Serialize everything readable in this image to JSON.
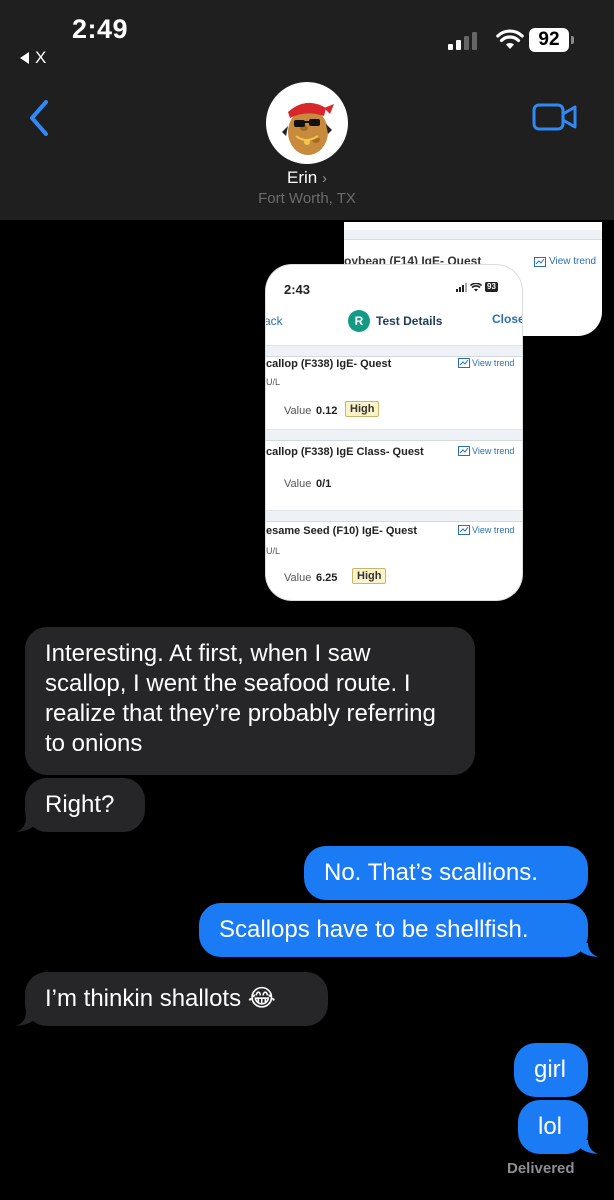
{
  "status_bar": {
    "time": "2:49",
    "back_app": "X",
    "battery": "92"
  },
  "header": {
    "contact_name": "Erin",
    "contact_location": "Fort Worth, TX"
  },
  "attachment": {
    "back_card": {
      "row_title": "oybean (F14) IgE- Quest",
      "trend_label": "View trend"
    },
    "front_card": {
      "time": "2:43",
      "battery": "93",
      "back_label": "ack",
      "logo_letter": "R",
      "title": "Test Details",
      "close_label": "Close",
      "tests": [
        {
          "title": "callop (F338) IgE- Quest",
          "unit": "U/L",
          "value_label": "Value",
          "value": "0.12",
          "flag": "High",
          "trend_label": "View trend"
        },
        {
          "title": "callop (F338) IgE Class- Quest",
          "unit": "",
          "value_label": "Value",
          "value": "0/1",
          "flag": "",
          "trend_label": "View trend"
        },
        {
          "title": "esame Seed (F10) IgE- Quest",
          "unit": "U/L",
          "value_label": "Value",
          "value": "6.25",
          "flag": "High",
          "trend_label": "View trend"
        }
      ]
    }
  },
  "messages": [
    {
      "direction": "incoming",
      "text": "Interesting. At first, when I saw scallop, I went the seafood route. I realize that they’re probably referring to onions"
    },
    {
      "direction": "incoming",
      "text": "Right?"
    },
    {
      "direction": "outgoing",
      "text": "No. That’s scallions."
    },
    {
      "direction": "outgoing",
      "text": "Scallops have to be shellfish."
    },
    {
      "direction": "incoming",
      "text": "I’m thinkin shallots 😂"
    },
    {
      "direction": "outgoing",
      "text": "girl"
    },
    {
      "direction": "outgoing",
      "text": "lol"
    }
  ],
  "delivery_status": "Delivered",
  "colors": {
    "incoming_bubble": "#262628",
    "outgoing_bubble": "#1b7bf5",
    "accent": "#2f8af5",
    "header_bg": "#1f1f1f"
  }
}
